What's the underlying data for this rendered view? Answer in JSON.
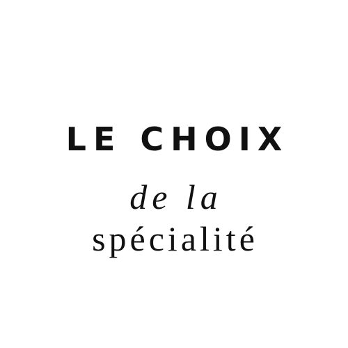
{
  "logo": {
    "line1": "LE CHOIX",
    "line2": "de la",
    "line3": "spécialité",
    "text_color": "#111111",
    "background_color": "#ffffff"
  }
}
